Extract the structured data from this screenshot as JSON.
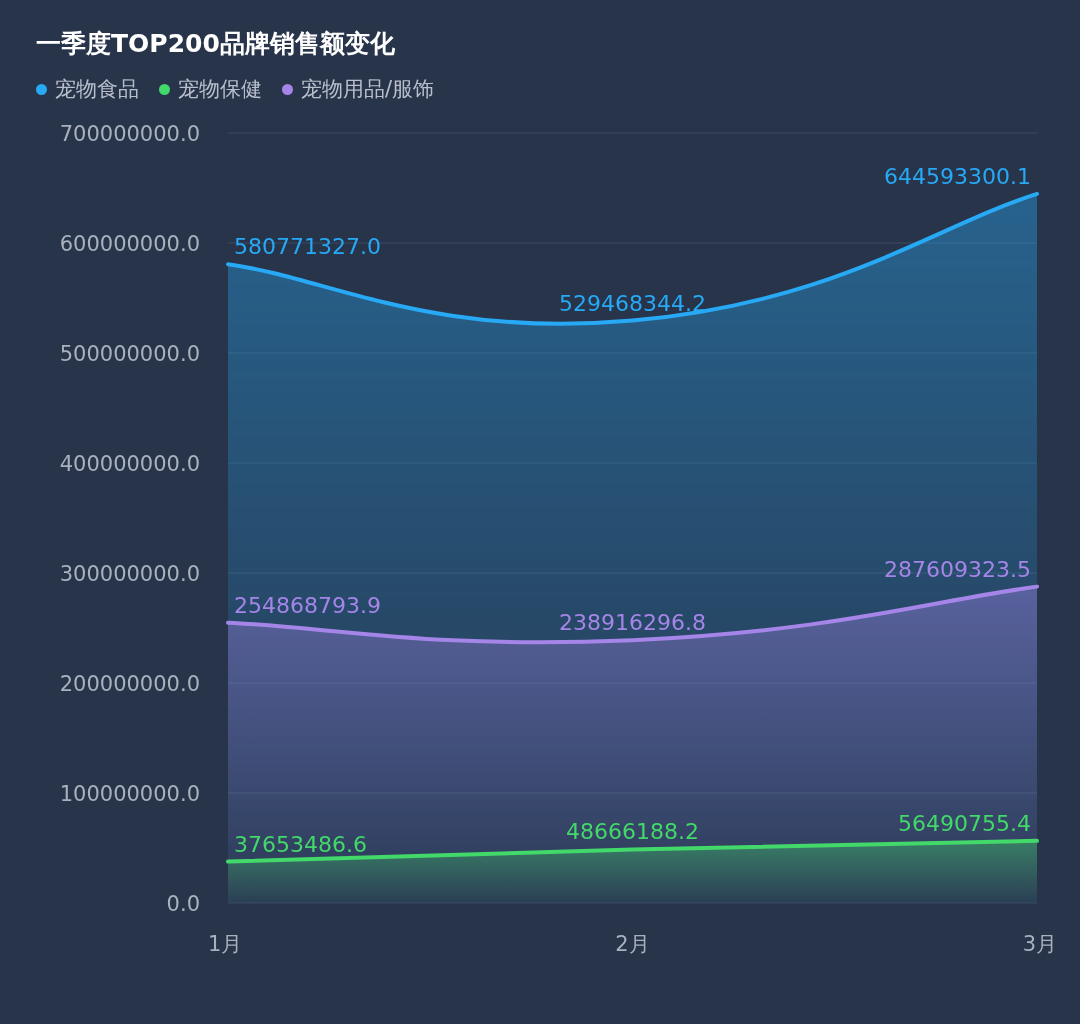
{
  "title": "一季度TOP200品牌销售额变化",
  "chart_data": {
    "type": "area",
    "categories": [
      "1月",
      "2月",
      "3月"
    ],
    "series": [
      {
        "name": "宠物食品",
        "color": "#27a9f5",
        "values": [
          580771327.0,
          529468344.2,
          644593300.1
        ]
      },
      {
        "name": "宠物保健",
        "color": "#42d86a",
        "values": [
          37653486.6,
          48666188.2,
          56490755.4
        ]
      },
      {
        "name": "宠物用品/服饰",
        "color": "#a585e8",
        "values": [
          254868793.9,
          238916296.8,
          287609323.5
        ]
      }
    ],
    "ylim": [
      0,
      700000000
    ],
    "yticks": [
      {
        "value": 0,
        "label": "0.0"
      },
      {
        "value": 100000000,
        "label": "100000000.0"
      },
      {
        "value": 200000000,
        "label": "200000000.0"
      },
      {
        "value": 300000000,
        "label": "300000000.0"
      },
      {
        "value": 400000000,
        "label": "400000000.0"
      },
      {
        "value": 500000000,
        "label": "500000000.0"
      },
      {
        "value": 600000000,
        "label": "600000000.0"
      },
      {
        "value": 700000000,
        "label": "700000000.0"
      }
    ],
    "grid": true,
    "value_labels": [
      [
        "580771327.0",
        "529468344.2",
        "644593300.1"
      ],
      [
        "37653486.6",
        "48666188.2",
        "56490755.4"
      ],
      [
        "254868793.9",
        "238916296.8",
        "287609323.5"
      ]
    ]
  }
}
